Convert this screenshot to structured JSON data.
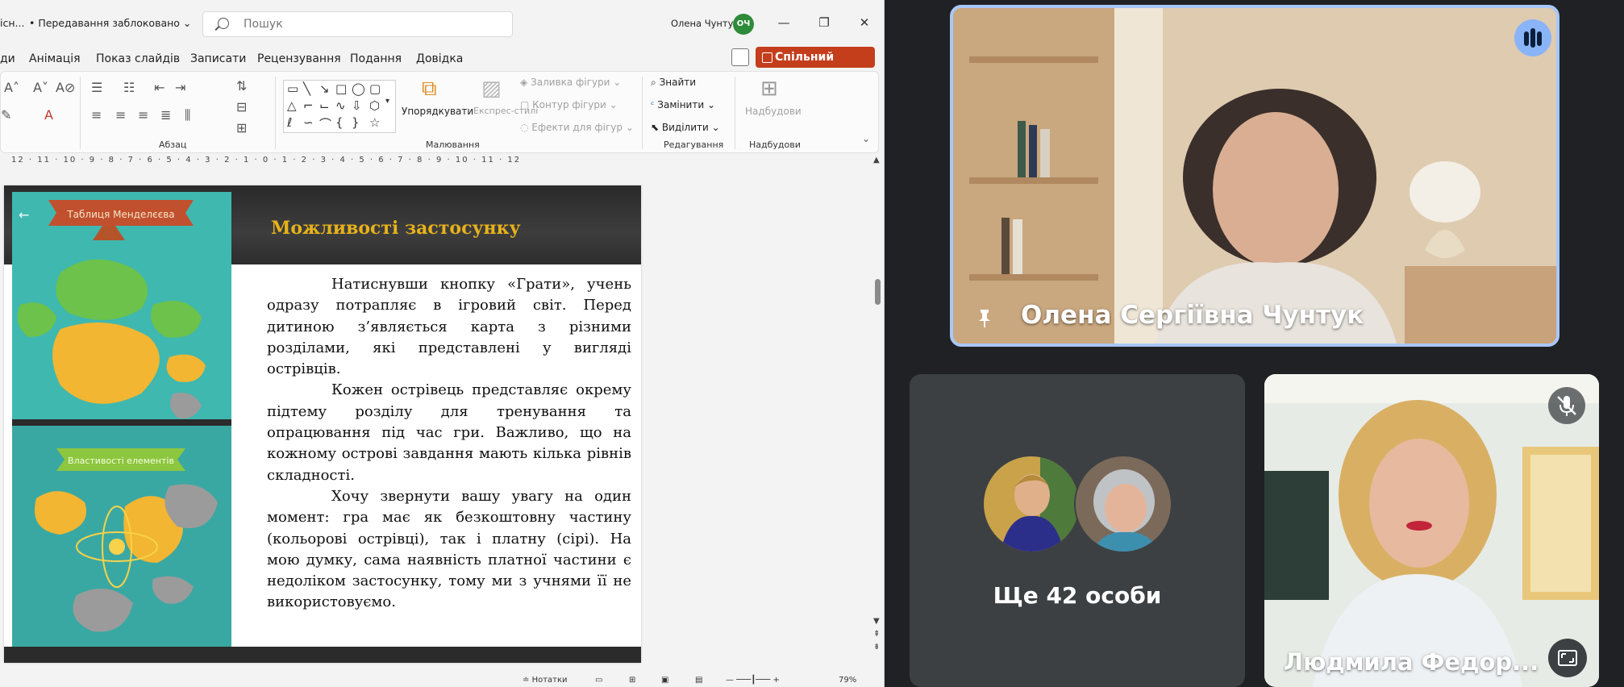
{
  "ppt": {
    "file_name": "існ...",
    "edit_status": "• Передавання заблоковано",
    "search_placeholder": "Пошук",
    "user_name": "Олена Чунтук",
    "user_initials": "ОЧ",
    "menu": [
      "ди",
      "Анімація",
      "Показ слайдів",
      "Записати",
      "Рецензування",
      "Подання",
      "Довідка"
    ],
    "share_label": "Спільний доступ",
    "ribbon": {
      "paragraph_label": "Абзац",
      "drawing_label": "Малювання",
      "editing_label": "Редагування",
      "addins_label": "Надбудови",
      "arrange": "Упорядкувати",
      "quick_styles": "Експрес-стилі",
      "shape_fill": "Заливка фігури",
      "shape_outline": "Контур фігури",
      "shape_effects": "Ефекти для фігур",
      "find": "Знайти",
      "replace": "Замінити",
      "select": "Виділити",
      "addins": "Надбудови"
    },
    "ruler": "12 · 11 · 10 · 9 · 8 · 7 · 6 · 5 · 4 · 3 · 2 · 1 · 0 · 1 · 2 · 3 · 4 · 5 · 6 · 7 · 8 · 9 · 10 · 11 · 12",
    "slide": {
      "title": "Можливості застосунку",
      "banner_top": "Таблиця Менделєєва",
      "banner_bottom": "Властивості елементів",
      "paragraphs": [
        "Натиснувши кнопку «Грати», учень одразу потрапляє в ігровий світ. Перед дитиною з’являється карта з різними розділами, які представлені у вигляді острівців.",
        "Кожен острівець представляє окрему підтему розділу для тренування та опрацювання під час гри. Важливо, що на кожному острові завдання мають кілька рівнів складності.",
        "Хочу звернути вашу увагу на один момент: гра має як безкоштовну частину (кольорові острівці), так і платну (сірі). На мою думку, сама наявність платної частини є недоліком застосунку, тому ми з учнями її не використовуємо."
      ]
    },
    "status": {
      "notes": "Нотатки",
      "zoom": "79%"
    }
  },
  "meet": {
    "speaker_name": "Олена Сергіївна Чунтук",
    "others_label": "Ще 42 особи",
    "participant_name": "Людмила Федор..."
  },
  "colors": {
    "share": "#c43e1c",
    "title_gold": "#e8b21a",
    "active_border": "#a8c7fa",
    "tile_bg": "#3c4043"
  }
}
